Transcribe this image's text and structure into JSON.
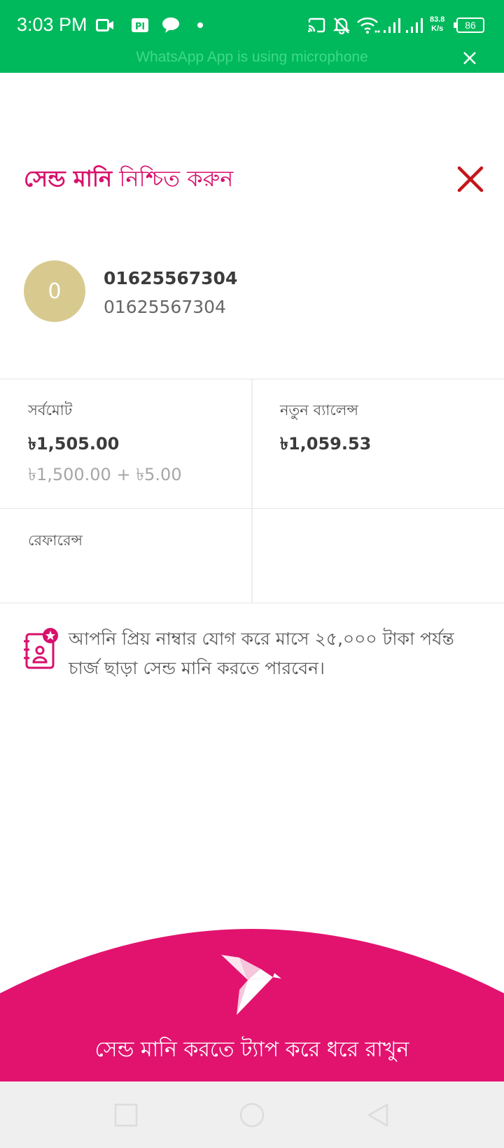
{
  "status_bar": {
    "time": "3:03 PM",
    "network_speed_value": "83.8",
    "network_speed_unit": "K/s",
    "battery_level": "86",
    "icons": [
      "video-call-icon",
      "pl-app-icon",
      "chat-bubble-icon",
      "dot-icon",
      "cast-icon",
      "bell-off-icon",
      "wifi-icon",
      "signal-icon",
      "signal-icon",
      "battery-icon"
    ],
    "background_color": "#00b95c"
  },
  "mic_banner": {
    "text": "WhatsApp App is using microphone"
  },
  "header": {
    "title_bold": "সেন্ড মানি",
    "title_rest": " নিশ্চিত করুন",
    "accent_color": "#d8106b",
    "close_color": "#c4161c"
  },
  "recipient": {
    "avatar_initial": "0",
    "avatar_color": "#d8c98f",
    "name": "01625567304",
    "number": "01625567304"
  },
  "summary": {
    "total_label": "সর্বমোট",
    "total_value": "৳1,505.00",
    "total_breakdown": "৳1,500.00 + ৳5.00",
    "new_balance_label": "নতুন ব্যালেন্স",
    "new_balance_value": "৳1,059.53",
    "reference_label": "রেফারেন্স",
    "reference_value": ""
  },
  "notice": {
    "icon": "favourite-contacts-icon",
    "text": "আপনি প্রিয় নাম্বার যোগ করে মাসে ২৫,০০০ টাকা পর্যন্ত চার্জ ছাড়া সেন্ড মানি করতে পারবেন।"
  },
  "action": {
    "icon": "bkash-bird-icon",
    "label": "সেন্ড মানি করতে ট্যাপ করে ধরে রাখুন",
    "color": "#e2136e"
  },
  "nav_bar": {
    "buttons": [
      "recents-square-icon",
      "home-circle-icon",
      "back-triangle-icon"
    ]
  }
}
